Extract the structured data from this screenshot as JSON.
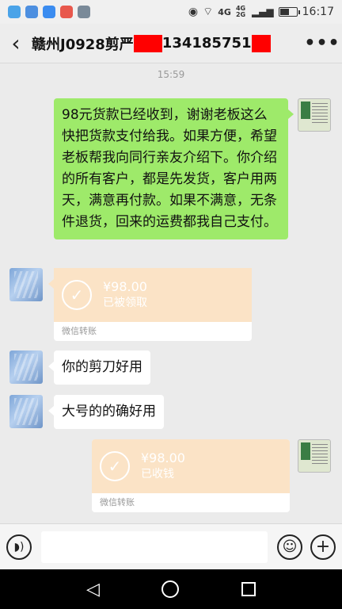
{
  "status_bar": {
    "network": "4G",
    "network2": "4G 2G",
    "time": "16:17",
    "battery_level": 0.6
  },
  "title_bar": {
    "title_prefix": "赣州J0928剪严",
    "title_number": "134185751",
    "back_icon": "chevron-left-icon",
    "more_icon": "ellipsis-icon"
  },
  "chat": {
    "timestamp": "15:59",
    "messages": [
      {
        "side": "right",
        "type": "text",
        "text": "98元货款已经收到，谢谢老板这么快把货款支付给我。如果方便，希望老板帮我向同行亲友介绍下。你介绍的所有客户，都是先发货，客户用两天，满意再付款。如果不满意，无条件退货，回来的运费都我自己支付。"
      },
      {
        "side": "left",
        "type": "transfer",
        "amount": "¥98.00",
        "status": "已被领取",
        "footer": "微信转账"
      },
      {
        "side": "left",
        "type": "text",
        "text": "你的剪刀好用"
      },
      {
        "side": "left",
        "type": "text",
        "text": "大号的的确好用"
      },
      {
        "side": "right",
        "type": "transfer",
        "amount": "¥98.00",
        "status": "已收钱",
        "footer": "微信转账"
      }
    ]
  },
  "input_bar": {
    "voice_icon": "voice-icon",
    "emoji_icon": "emoji-icon",
    "plus_icon": "plus-icon",
    "placeholder": ""
  },
  "colors": {
    "green_bubble": "#9eea6a",
    "transfer_bg": "#fbe3c6",
    "redaction": "#ff0000"
  }
}
